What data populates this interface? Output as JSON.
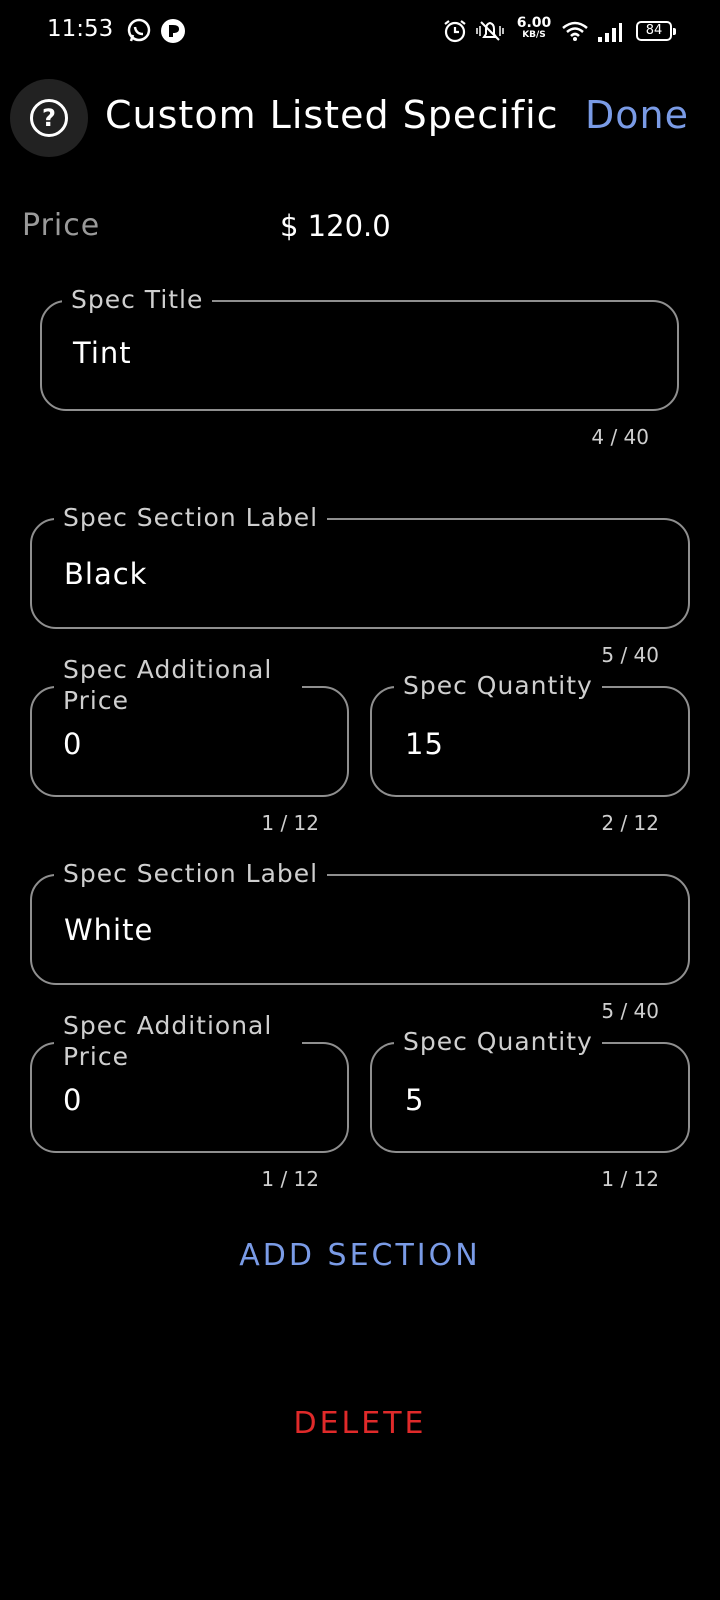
{
  "status_bar": {
    "time": "11:53",
    "net_speed_value": "6.00",
    "net_speed_unit": "KB/S",
    "battery": "84",
    "icons": [
      "whatsapp-icon",
      "app-icon",
      "alarm-icon",
      "mute-icon",
      "wifi-icon",
      "signal-icon",
      "battery-icon"
    ]
  },
  "header": {
    "help_icon": "?",
    "title": "Custom Listed Specific",
    "done_label": "Done"
  },
  "price": {
    "label": "Price",
    "value": "$ 120.0"
  },
  "spec_title": {
    "label": "Spec Title",
    "value": "Tint",
    "counter": "4 / 40"
  },
  "sections": [
    {
      "label_field": {
        "label": "Spec Section Label",
        "value": "Black",
        "counter": "5 / 40"
      },
      "additional_price": {
        "label": "Spec Additional Price",
        "value": "0",
        "counter": "1 / 12"
      },
      "quantity": {
        "label": "Spec Quantity",
        "value": "15",
        "counter": "2 / 12"
      }
    },
    {
      "label_field": {
        "label": "Spec Section Label",
        "value": "White",
        "counter": "5 / 40"
      },
      "additional_price": {
        "label": "Spec Additional Price",
        "value": "0",
        "counter": "1 / 12"
      },
      "quantity": {
        "label": "Spec Quantity",
        "value": "5",
        "counter": "1 / 12"
      }
    }
  ],
  "actions": {
    "add_section": "ADD SECTION",
    "delete": "DELETE"
  },
  "colors": {
    "accent": "#7a9be6",
    "danger": "#e02a2a",
    "background": "#000000",
    "outline": "#8f8f8f"
  }
}
